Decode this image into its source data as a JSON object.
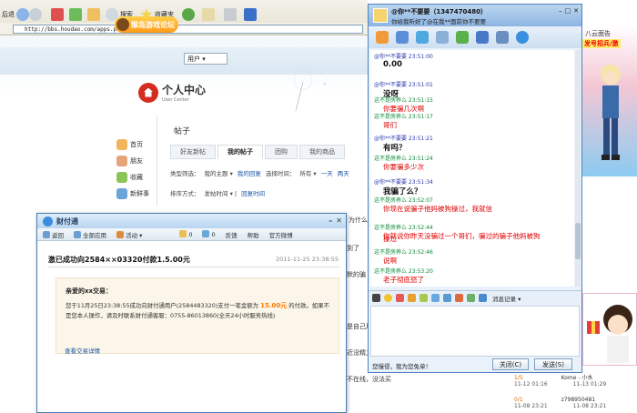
{
  "browser": {
    "back_label": "后退",
    "search_label": "搜索",
    "favorites_label": "收藏夹",
    "address_value": "http://bbs.houdao.com/apps.php?q=article"
  },
  "site": {
    "logo_text": "猴岛游戏论坛",
    "user_dropdown": "用户",
    "user_center_title": "个人中心",
    "user_center_subtitle": "User Center",
    "side_nav": [
      "首页",
      "朋友",
      "收藏",
      "新鲜事"
    ],
    "content_title": "帖子",
    "tabs": [
      "好友新帖",
      "我的帖子",
      "团购",
      "我的商品"
    ],
    "filter_row1": [
      "类型筛选：",
      "我的主题",
      "我的回复",
      "选择时间：",
      "所有",
      "一天",
      "两天"
    ],
    "filter_row2": [
      "排序方式：",
      "发帖时间",
      "回复时间"
    ],
    "fragments": [
      "为什么",
      "到了",
      "默的骗",
      "是自己用",
      "近没精力",
      "不在线，没法买"
    ]
  },
  "payment": {
    "window_title": "财付通",
    "nav": [
      "返回",
      "全部应用",
      "活动",
      "0",
      "0",
      "反馈",
      "帮助",
      "官方微博"
    ],
    "subject": "激已成功向2584××03320付款1.5.00元",
    "date": "2011-11-25 23:38:55",
    "greeting": "亲爱的xx交易：",
    "text_part1": "您于11月25日23:38:55成功向财付通用户(2584483320)支付一笔金额为",
    "amount": "15.00元",
    "text_part2": "的付款。如果不是您本人操作，请及时联系财付通客服：0755-86013860(全天24小时服务热线)",
    "link_text": "查看交易详情"
  },
  "qq": {
    "contact_name": "@你**不要要（1347470480）",
    "signature": "你给我听好了@在我**面前你不要要",
    "messages": [
      {
        "who": "me",
        "head": "@你**不要要    23:51:00",
        "body": "0.00"
      },
      {
        "who": "me",
        "head": "@你**不要要    23:51:01",
        "body": "没呀"
      },
      {
        "who": "them",
        "head": "这不是房养么    23:51:15",
        "body": "你要骗几次啊"
      },
      {
        "who": "them",
        "head": "这不是房养么    23:51:17",
        "body": "哥们"
      },
      {
        "who": "me",
        "head": "@你**不要要    23:51:21",
        "body": "有吗？"
      },
      {
        "who": "them",
        "head": "这不是房养么    23:51:24",
        "body": "你要骗多少次"
      },
      {
        "who": "me",
        "head": "@你**不要要    23:51:34",
        "body": "我骗了么？"
      },
      {
        "who": "them",
        "head": "这不是房养么    23:52:07",
        "body": "你现在说骗子他妈被狗操过，我就信"
      },
      {
        "who": "them",
        "head": "这不是房养么    23:52:44",
        "body": "你就说你昨天没骗过一个哥们，骗过的骗子他妈被狗"
      },
      {
        "who": "them_cont",
        "head": "",
        "body": "操过"
      },
      {
        "who": "them",
        "head": "这不是房养么    23:52:46",
        "body": "说啊"
      },
      {
        "who": "them",
        "head": "这不是房养么    23:53:20",
        "body": "老子彻底怒了"
      }
    ],
    "message_record_label": "消息记录",
    "footer_text": "您慢侵，我为您免单！",
    "close_button": "关闭(C)",
    "send_button": "发送(S)"
  },
  "ads": {
    "title1": "八云面告",
    "title2": "发号招兵/激"
  },
  "table": {
    "row1": [
      "1/5",
      "11-12 01:16",
      "Kome - 小水",
      "11-13 01:29"
    ],
    "row2": [
      "0/1",
      "11-08 23:21",
      "z798950481",
      "11-08 23:21"
    ]
  }
}
